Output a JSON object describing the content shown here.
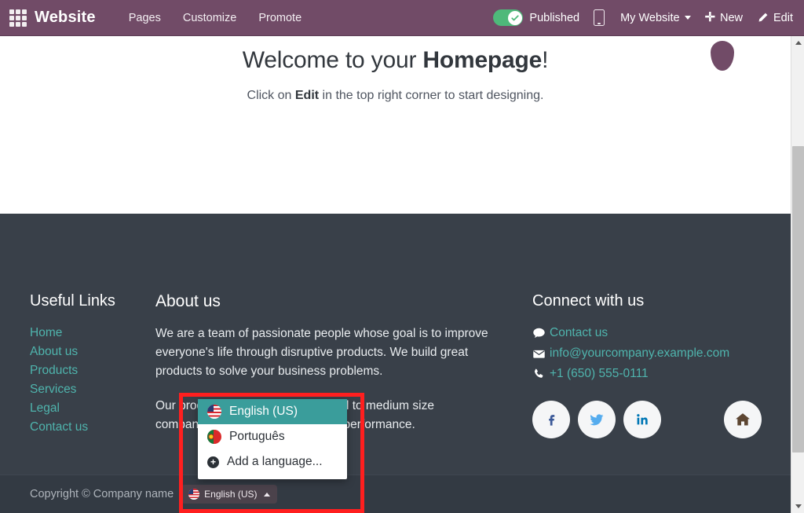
{
  "topbar": {
    "apps_icon": "apps-grid-icon",
    "brand": "Website",
    "menu": [
      {
        "label": "Pages"
      },
      {
        "label": "Customize"
      },
      {
        "label": "Promote"
      }
    ],
    "publish_toggle": {
      "state": "on",
      "icon": "check-icon",
      "color": "#4eb97a"
    },
    "published_label": "Published",
    "mobile_preview_icon": "mobile-phone-icon",
    "site_selector": {
      "label": "My Website",
      "caret_icon": "chevron-down-icon"
    },
    "new_button": {
      "label": "New",
      "icon": "plus-icon"
    },
    "edit_button": {
      "label": "Edit",
      "icon": "pencil-icon"
    }
  },
  "hero": {
    "title_prefix": "Welcome to your ",
    "title_strong": "Homepage",
    "title_suffix": "!",
    "subtitle_prefix": "Click on ",
    "subtitle_strong": "Edit",
    "subtitle_suffix": " in the top right corner to start designing.",
    "decoration_icon": "water-drop-shape"
  },
  "footer": {
    "useful_links": {
      "title": "Useful Links",
      "items": [
        {
          "label": "Home"
        },
        {
          "label": "About us"
        },
        {
          "label": "Products"
        },
        {
          "label": "Services"
        },
        {
          "label": "Legal"
        },
        {
          "label": "Contact us"
        }
      ]
    },
    "about": {
      "title": "About us",
      "paragraph_1": "We are a team of passionate people whose goal is to improve everyone's life through disruptive products. We build great products to solve your business problems.",
      "paragraph_2": "Our products are designed for small to medium size companies willing to optimize their performance."
    },
    "connect": {
      "title": "Connect with us",
      "rows": [
        {
          "icon": "comment-icon",
          "label": "Contact us"
        },
        {
          "icon": "envelope-icon",
          "label": "info@yourcompany.example.com"
        },
        {
          "icon": "phone-icon",
          "label": "+1 (650) 555-0111"
        }
      ],
      "socials": [
        {
          "icon": "facebook-icon",
          "name": "Facebook"
        },
        {
          "icon": "twitter-icon",
          "name": "Twitter"
        },
        {
          "icon": "linkedin-icon",
          "name": "LinkedIn"
        },
        {
          "icon": "home-icon",
          "name": "Home"
        }
      ]
    },
    "copyright": "Copyright © Company name",
    "language_button": {
      "label": "English (US)",
      "flag": "flag-us",
      "caret_icon": "chevron-up-icon"
    }
  },
  "language_dropdown": {
    "items": [
      {
        "label": "English (US)",
        "flag": "flag-us",
        "selected": true
      },
      {
        "label": "Português",
        "flag": "flag-pt",
        "selected": false
      },
      {
        "label": "Add a language...",
        "icon": "plus-circle-icon",
        "selected": false
      }
    ]
  },
  "annotation": {
    "color": "#ff1f1f",
    "shape": "rectangle-highlight"
  },
  "scrollbar": {
    "up_icon": "triangle-up-icon",
    "down_icon": "triangle-down-icon"
  },
  "colors": {
    "brand_purple": "#714b67",
    "footer_dark": "#394049",
    "copyright_dark": "#333a43",
    "link_teal": "#4fb4ad",
    "dropdown_active_teal": "#3a9d9b",
    "toggle_green": "#4eb97a",
    "annotation_red": "#ff1f1f"
  }
}
